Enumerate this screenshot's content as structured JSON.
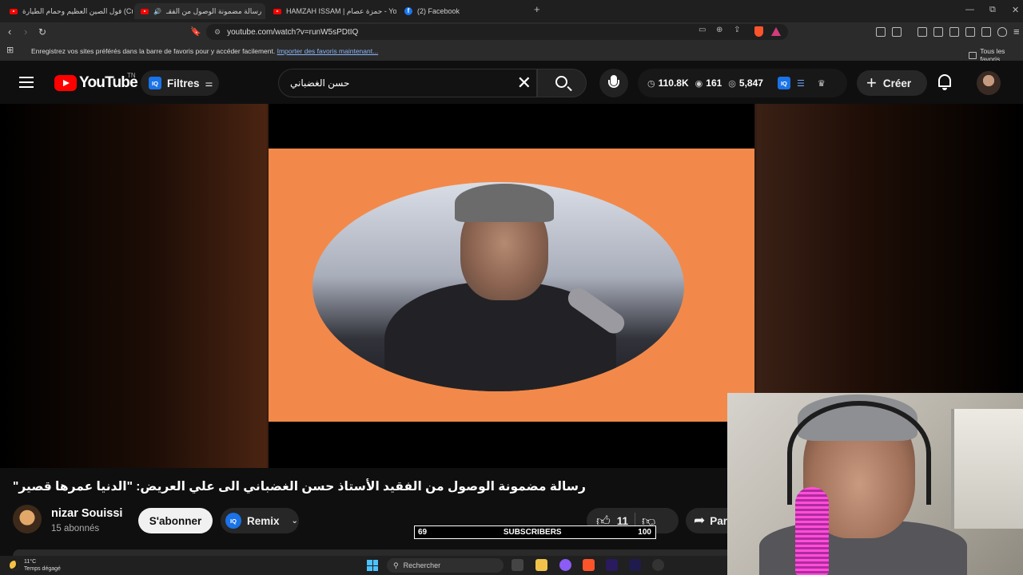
{
  "browser": {
    "tabs": [
      {
        "title": "فول الصين العظيم وحمام الطيارة (Crisis)",
        "icon": "youtube-icon"
      },
      {
        "title": "رسالة مضمونة الوصول من الفقـ",
        "icon": "youtube-icon",
        "active": true
      },
      {
        "title": "HAMZAH ISSAM | حمزة عصام - YouTube",
        "icon": "youtube-icon"
      },
      {
        "title": "(2) Facebook",
        "icon": "facebook-icon"
      }
    ],
    "new_tab": "+",
    "window_controls": {
      "minimize": "—",
      "maximize": "⧉",
      "close": "✕"
    },
    "url": "youtube.com/watch?v=runW5sPDtIQ",
    "bookmarks_bar": {
      "message": "Enregistrez vos sites préférés dans la barre de favoris pour y accéder facilement.",
      "link": "Importer des favoris maintenant...",
      "all_bookmarks": "Tous les favoris"
    }
  },
  "youtube": {
    "logo_text": "YouTube",
    "country": "TN",
    "iq_label": "IQ",
    "filters_label": "Filtres",
    "search_query": "حسن الغضباني",
    "stats": {
      "views": "110.8K",
      "watching": "161",
      "impressions": "5,847"
    },
    "create_label": "Créer"
  },
  "video": {
    "title": "\"رسالة مضمونة الوصول من الفقيد الأستاذ حسن الغضباني الى علي العريض: \"الدنيا عمرها قصير",
    "channel_name": "nizar Souissi",
    "subscribers": "15 abonnés",
    "subscribe_label": "S'abonner",
    "remix_label": "Remix",
    "likes": "11",
    "share_label": "Partager"
  },
  "overlay": {
    "sub_count_current": "69",
    "sub_label": "SUBSCRIBERS",
    "sub_goal": "100"
  },
  "taskbar": {
    "temperature": "11°C",
    "weather": "Temps dégagé",
    "search_placeholder": "Rechercher"
  },
  "colors": {
    "youtube_red": "#ff0000",
    "video_background": "#f2894a",
    "iq_blue": "#1a73e8"
  }
}
